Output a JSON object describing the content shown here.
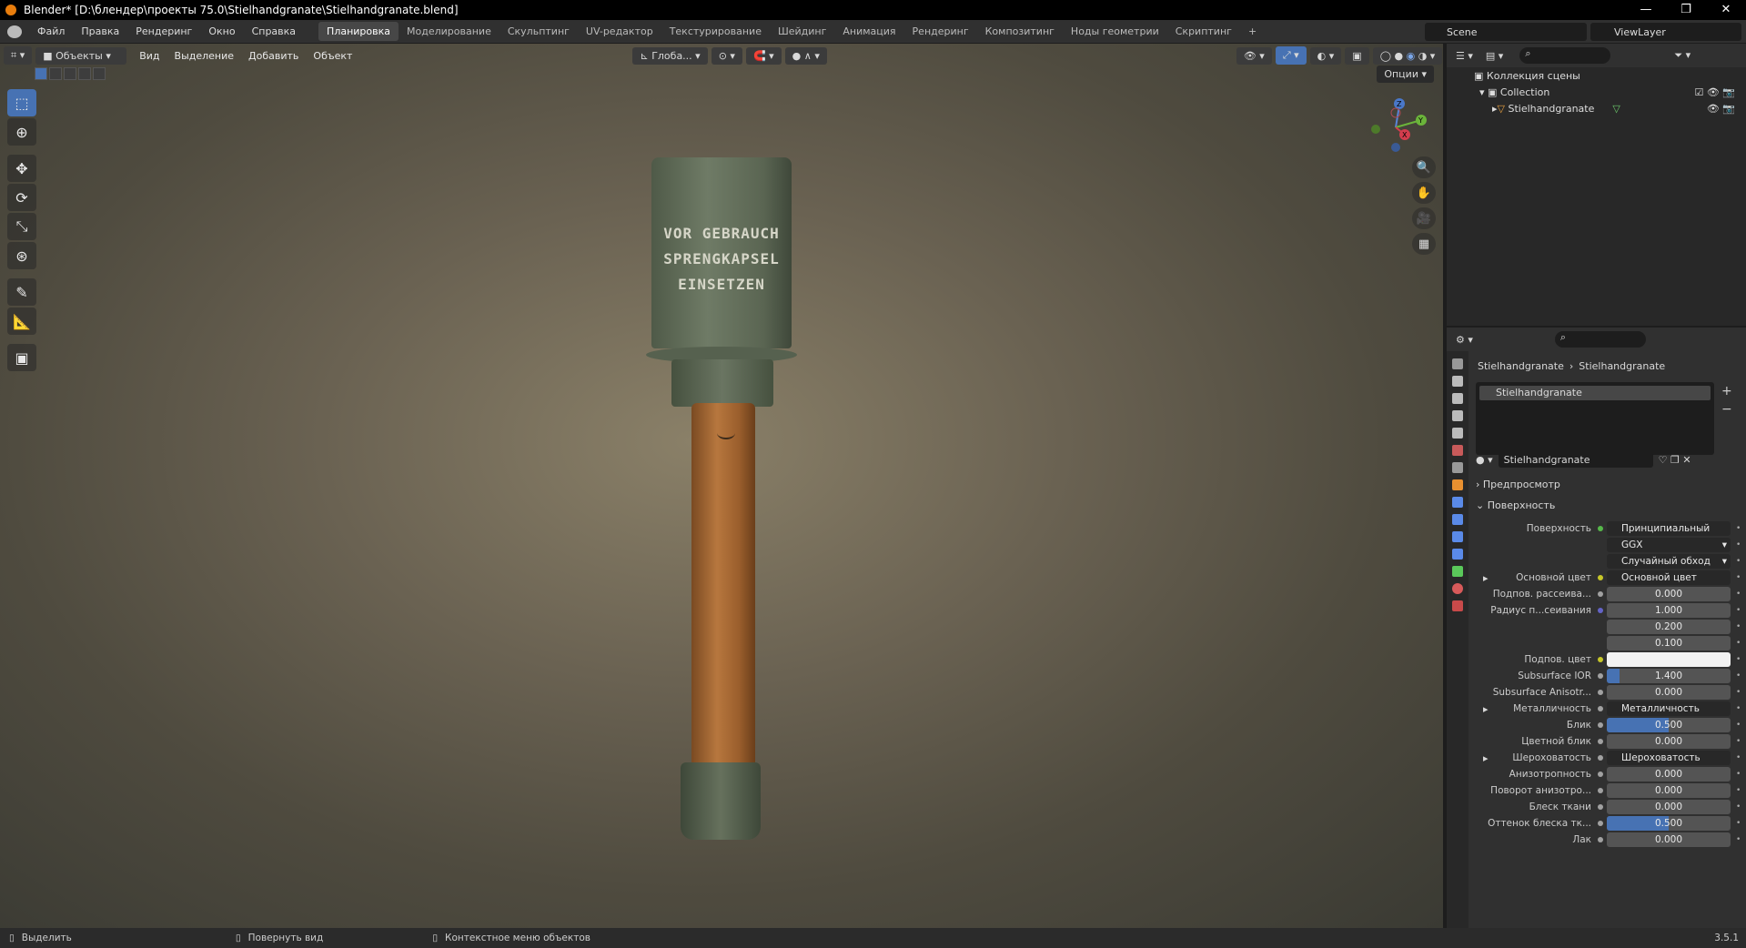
{
  "window": {
    "title": "Blender* [D:\\блендер\\проекты 75.0\\Stielhandgranate\\Stielhandgranate.blend]",
    "minimize": "—",
    "maximize": "❐",
    "close": "✕"
  },
  "menu": [
    "Файл",
    "Правка",
    "Рендеринг",
    "Окно",
    "Справка"
  ],
  "workspaces": [
    "Планировка",
    "Моделирование",
    "Скульптинг",
    "UV-редактор",
    "Текстурирование",
    "Шейдинг",
    "Анимация",
    "Рендеринг",
    "Композитинг",
    "Ноды геометрии",
    "Скриптинг",
    "+"
  ],
  "scene": "Scene",
  "view_layer": "ViewLayer",
  "viewport": {
    "mode": "Объекты",
    "menus": [
      "Вид",
      "Выделение",
      "Добавить",
      "Объект"
    ],
    "transform": "Глоба...",
    "options": "Опции",
    "axes": {
      "z": "Z",
      "y": "Y",
      "x": "X"
    },
    "grenade_text": [
      "VOR GEBRAUCH",
      "SPRENGKAPSEL",
      "EINSETZEN"
    ]
  },
  "outliner": {
    "root": "Коллекция сцены",
    "collection": "Collection",
    "object": "Stielhandgranate"
  },
  "properties": {
    "breadcrumb": [
      "Stielhandgranate",
      "Stielhandgranate"
    ],
    "slot": "Stielhandgranate",
    "material": "Stielhandgranate",
    "preview": "Предпросмотр",
    "surface_panel": "Поверхность",
    "rows": [
      {
        "label": "Поверхность",
        "value": "Принципиальный BSDF",
        "type": "link",
        "dot": "#56b84a"
      },
      {
        "label": "",
        "value": "GGX",
        "type": "dropdown"
      },
      {
        "label": "",
        "value": "Случайный обход",
        "type": "dropdown"
      },
      {
        "label": "Основной цвет",
        "value": "Основной цвет",
        "type": "link",
        "dot": "#c7c729",
        "expand": true
      },
      {
        "label": "Подпов. рассеива...",
        "value": "0.000",
        "type": "num",
        "dot": "#a1a1a1"
      },
      {
        "label": "Радиус п...сеивания",
        "value": "1.000",
        "type": "num",
        "dot": "#6363c7"
      },
      {
        "label": "",
        "value": "0.200",
        "type": "num"
      },
      {
        "label": "",
        "value": "0.100",
        "type": "num"
      },
      {
        "label": "Подпов. цвет",
        "value": "",
        "type": "color",
        "dot": "#c7c729"
      },
      {
        "label": "Subsurface IOR",
        "value": "1.400",
        "type": "num",
        "dot": "#a1a1a1",
        "fill": 0.1
      },
      {
        "label": "Subsurface Anisotr...",
        "value": "0.000",
        "type": "num",
        "dot": "#a1a1a1"
      },
      {
        "label": "Металличность",
        "value": "Металличность",
        "type": "link",
        "dot": "#a1a1a1",
        "expand": true
      },
      {
        "label": "Блик",
        "value": "0.500",
        "type": "num",
        "dot": "#a1a1a1",
        "fill": 0.5
      },
      {
        "label": "Цветной блик",
        "value": "0.000",
        "type": "num",
        "dot": "#a1a1a1"
      },
      {
        "label": "Шероховатость",
        "value": "Шероховатость",
        "type": "link",
        "dot": "#a1a1a1",
        "expand": true
      },
      {
        "label": "Анизотропность",
        "value": "0.000",
        "type": "num",
        "dot": "#a1a1a1"
      },
      {
        "label": "Поворот анизотро...",
        "value": "0.000",
        "type": "num",
        "dot": "#a1a1a1"
      },
      {
        "label": "Блеск ткани",
        "value": "0.000",
        "type": "num",
        "dot": "#a1a1a1"
      },
      {
        "label": "Оттенок блеска тк...",
        "value": "0.500",
        "type": "num",
        "dot": "#a1a1a1",
        "fill": 0.5
      },
      {
        "label": "Лак",
        "value": "0.000",
        "type": "num",
        "dot": "#a1a1a1"
      }
    ]
  },
  "status": {
    "select": "Выделить",
    "rotate": "Повернуть вид",
    "context": "Контекстное меню объектов",
    "version": "3.5.1"
  }
}
